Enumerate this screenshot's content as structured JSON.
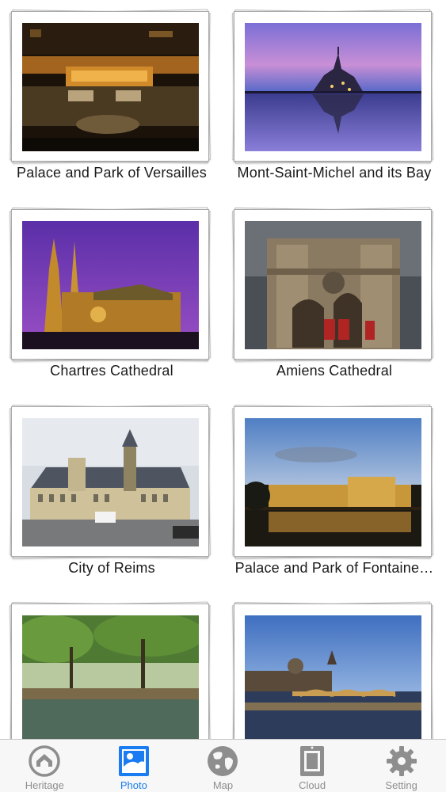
{
  "grid": {
    "items": [
      {
        "title": "Palace and Park of Versailles",
        "photo": "versailles-photo"
      },
      {
        "title": "Mont-Saint-Michel and its Bay",
        "photo": "mont-saint-michel-photo"
      },
      {
        "title": "Chartres Cathedral",
        "photo": "chartres-photo"
      },
      {
        "title": "Amiens Cathedral",
        "photo": "amiens-photo"
      },
      {
        "title": "City of Reims",
        "photo": "reims-photo"
      },
      {
        "title": "Palace and Park of Fontaine…",
        "photo": "fontainebleau-photo"
      },
      {
        "title": "",
        "photo": "canal-photo"
      },
      {
        "title": "",
        "photo": "paris-seine-photo"
      }
    ]
  },
  "tabbar": {
    "active": "Photo",
    "active_color": "#1a7cf0",
    "inactive_color": "#8e8e8e",
    "tabs": [
      {
        "label": "Heritage",
        "icon": "heritage-icon"
      },
      {
        "label": "Photo",
        "icon": "photo-icon"
      },
      {
        "label": "Map",
        "icon": "globe-icon"
      },
      {
        "label": "Cloud",
        "icon": "cloud-icon"
      },
      {
        "label": "Setting",
        "icon": "gear-icon"
      }
    ]
  }
}
